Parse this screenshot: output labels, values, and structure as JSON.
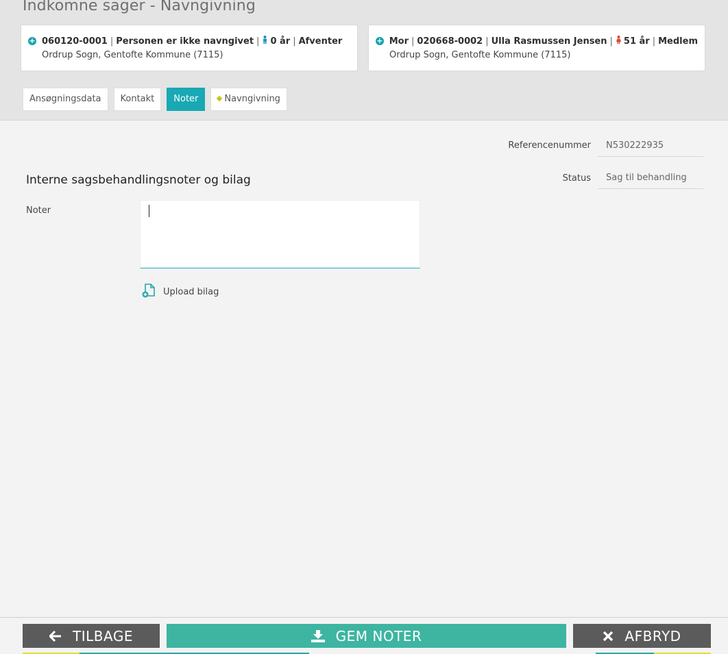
{
  "page": {
    "title": "Indkomne sager - Navngivning"
  },
  "child_card": {
    "cpr": "060120-0001",
    "name": "Personen er ikke navngivet",
    "age": "0 år",
    "status": "Afventer",
    "parish": "Ordrup Sogn, Gentofte Kommune (7115)",
    "icon": "male-person-icon",
    "icon_color": "#1a8fb8"
  },
  "mother_card": {
    "relation": "Mor",
    "cpr": "020668-0002",
    "name": "Ulla Rasmussen Jensen",
    "age": "51 år",
    "status": "Medlem",
    "parish": "Ordrup Sogn, Gentofte Kommune (7115)",
    "icon": "female-person-icon",
    "icon_color": "#d9472b"
  },
  "tabs": [
    {
      "label": "Ansøgningsdata",
      "active": false
    },
    {
      "label": "Kontakt",
      "active": false
    },
    {
      "label": "Noter",
      "active": true
    },
    {
      "label": "Navngivning",
      "active": false,
      "marker": "yellow-diamond"
    }
  ],
  "fields": {
    "reference_label": "Referencenummer",
    "reference_value": "N530222935",
    "status_label": "Status",
    "status_value": "Sag til behandling"
  },
  "notes": {
    "section_title": "Interne sagsbehandlingsnoter og bilag",
    "label": "Noter",
    "value": "",
    "upload_label": "Upload bilag"
  },
  "footer": {
    "back_label": "TILBAGE",
    "save_label": "GEM NOTER",
    "cancel_label": "AFBRYD"
  },
  "colors": {
    "accent": "#18a9b4",
    "save_button": "#3db5a1",
    "dark_button": "#5b5b5b",
    "strip_yellow": "#e3dc3a",
    "strip_teal": "#2aa6a9"
  }
}
